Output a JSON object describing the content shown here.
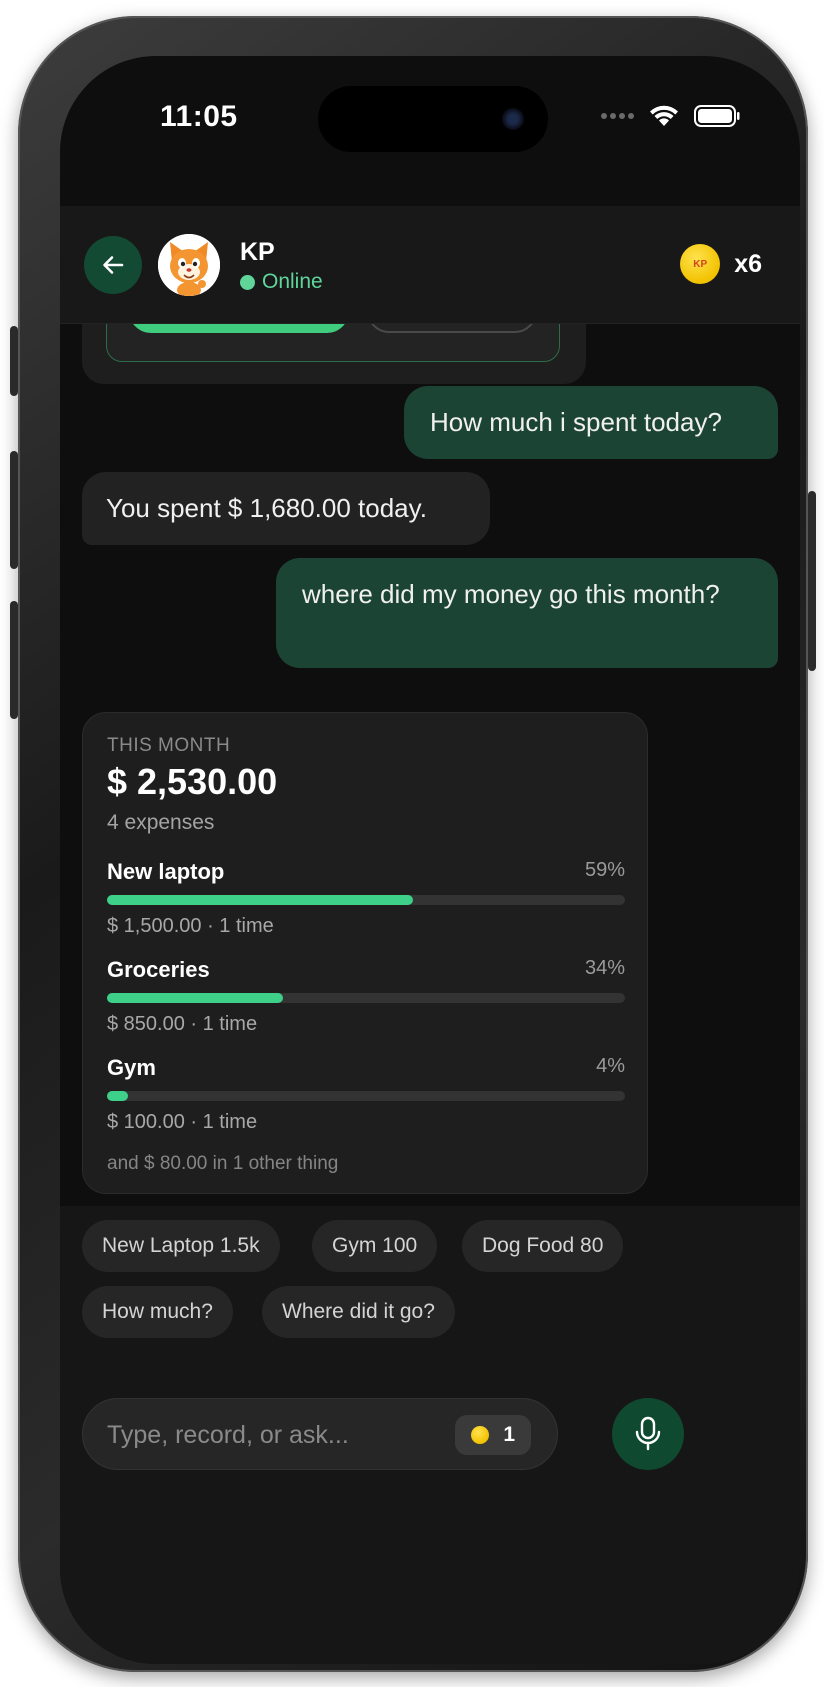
{
  "status": {
    "time": "11:05"
  },
  "header": {
    "contact_name": "KP",
    "presence": "Online",
    "coin_label": "KP",
    "coin_count": "x6",
    "accent": "#5fd59a"
  },
  "messages": [
    {
      "role": "user",
      "text": "How much i spent today?"
    },
    {
      "role": "bot",
      "text": "You spent $ 1,680.00 today."
    },
    {
      "role": "user",
      "text": "where did my money go this month?"
    }
  ],
  "summary": {
    "label": "THIS MONTH",
    "total": "$ 2,530.00",
    "count": "4 expenses",
    "categories": [
      {
        "name": "New laptop",
        "percent_label": "59%",
        "percent": 59,
        "detail": "$ 1,500.00 · 1 time"
      },
      {
        "name": "Groceries",
        "percent_label": "34%",
        "percent": 34,
        "detail": "$ 850.00 · 1 time"
      },
      {
        "name": "Gym",
        "percent_label": "4%",
        "percent": 4,
        "detail": "$ 100.00 · 1 time"
      }
    ],
    "other": "and $ 80.00 in 1 other thing"
  },
  "quick_replies": [
    "New Laptop 1.5k",
    "Gym 100",
    "Dog Food 80",
    "How much?",
    "Where did it go?"
  ],
  "composer": {
    "placeholder": "Type, record, or ask...",
    "coin_cost": "1"
  }
}
